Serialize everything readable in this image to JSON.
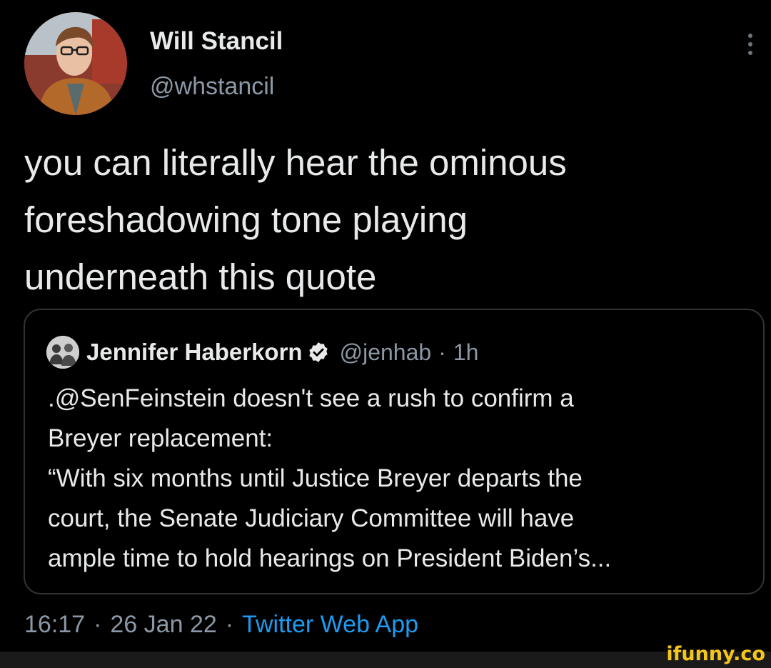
{
  "author": {
    "display_name": "Will Stancil",
    "handle": "@whstancil",
    "avatar_icon": "profile-photo"
  },
  "tweet": {
    "text": "you can literally hear the ominous\nforeshadowing tone playing\nunderneath this quote"
  },
  "quoted_tweet": {
    "display_name": "Jennifer Haberkorn",
    "verified": true,
    "handle": "@jenhab",
    "separator": "·",
    "time_ago": "1h",
    "text": ".@SenFeinstein doesn't see a rush to confirm a\nBreyer replacement:\n“With six months until Justice Breyer departs the\ncourt, the Senate Judiciary Committee will have\nample time to hold hearings on President Biden’s..."
  },
  "meta": {
    "time": "16:17",
    "sep1": "·",
    "date": "26 Jan 22",
    "sep2": "·",
    "source": "Twitter Web App"
  },
  "watermark": {
    "text": "ifunny.co"
  },
  "colors": {
    "background": "#000000",
    "primary_text": "#e7e9ea",
    "secondary_text": "#8b98a5",
    "link": "#1d9bf0",
    "border": "#2f3336",
    "watermark": "#f5c518"
  }
}
